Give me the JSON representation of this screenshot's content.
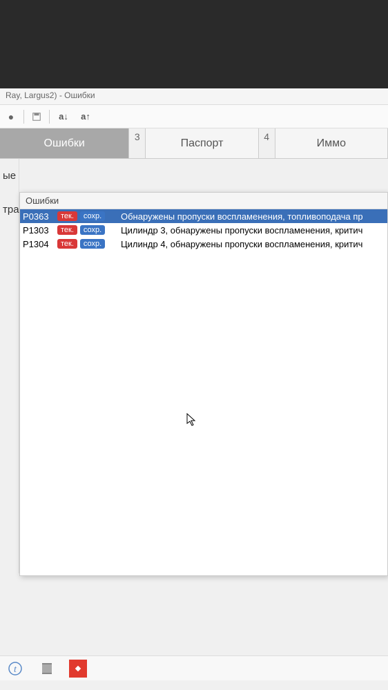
{
  "window": {
    "title": "Ray, Largus2) - Ошибки"
  },
  "toolbar": {
    "text_decrease": "a↓",
    "text_increase": "a↑"
  },
  "tabs": [
    {
      "number": "",
      "label": "Ошибки",
      "active": true
    },
    {
      "number": "3",
      "label": "Паспорт",
      "active": false
    },
    {
      "number": "4",
      "label": "Иммо",
      "active": false
    }
  ],
  "side_labels": [
    "ые",
    "тра"
  ],
  "errors_panel": {
    "title": "Ошибки",
    "rows": [
      {
        "code": "P0363",
        "badge1": "тек.",
        "badge2": "сохр.",
        "description": "Обнаружены пропуски воспламенения, топливоподача пр",
        "selected": true
      },
      {
        "code": "P1303",
        "badge1": "тек.",
        "badge2": "сохр.",
        "description": "Цилиндр 3, обнаружены пропуски воспламенения, критич",
        "selected": false
      },
      {
        "code": "P1304",
        "badge1": "тек.",
        "badge2": "сохр.",
        "description": "Цилиндр 4, обнаружены пропуски воспламенения, критич",
        "selected": false
      }
    ]
  }
}
